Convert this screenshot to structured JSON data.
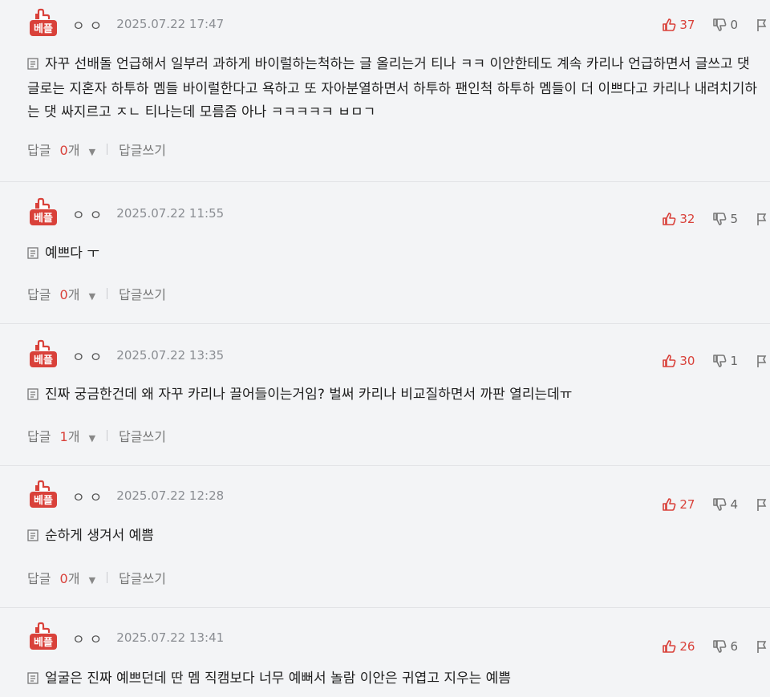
{
  "badge_label": "베플",
  "reply_label": "답글",
  "reply_count_suffix": "개",
  "write_reply_label": "답글쓰기",
  "accent_color": "#d9413a",
  "comments": [
    {
      "author": "ㅇㅇ",
      "date": "2025.07.22 17:47",
      "likes": "37",
      "dislikes": "0",
      "text": "자꾸 선배돌 언급해서 일부러 과하게 바이럴하는척하는 글 올리는거 티나 ㅋㅋ 이안한테도 계속 카리나 언급하면서 글쓰고 댓글로는 지혼자 하투하 멤들 바이럴한다고 욕하고 또 자아분열하면서 하투하 팬인척 하투하 멤들이 더 이쁘다고 카리나 내려치기하는 댓 싸지르고 ㅈㄴ 티나는데 모름즘 아나 ㅋㅋㅋㅋㅋ ㅂㅁㄱ",
      "reply_count": "0"
    },
    {
      "author": "ㅇㅇ",
      "date": "2025.07.22 11:55",
      "likes": "32",
      "dislikes": "5",
      "text": "예쁘다 ㅜ",
      "reply_count": "0"
    },
    {
      "author": "ㅇㅇ",
      "date": "2025.07.22 13:35",
      "likes": "30",
      "dislikes": "1",
      "text": "진짜 궁금한건데 왜 자꾸 카리나 끌어들이는거임? 벌써 카리나 비교질하면서 까판 열리는데ㅠ",
      "reply_count": "1"
    },
    {
      "author": "ㅇㅇ",
      "date": "2025.07.22 12:28",
      "likes": "27",
      "dislikes": "4",
      "text": "순하게 생겨서 예쁨",
      "reply_count": "0"
    },
    {
      "author": "ㅇㅇ",
      "date": "2025.07.22 13:41",
      "likes": "26",
      "dislikes": "6",
      "text": "얼굴은 진짜 예쁘던데 딴 멤 직캠보다 너무 예뻐서 놀람 이안은 귀엽고 지우는 예쁨"
    }
  ]
}
